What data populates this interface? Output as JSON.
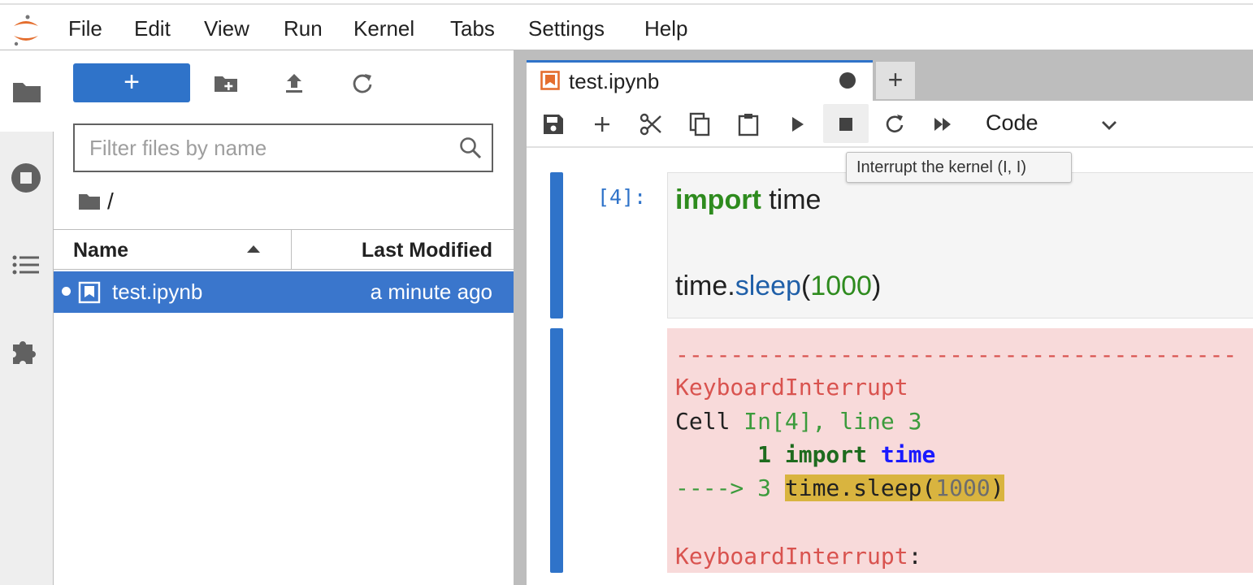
{
  "menu": {
    "items": [
      "File",
      "Edit",
      "View",
      "Run",
      "Kernel",
      "Tabs",
      "Settings",
      "Help"
    ]
  },
  "activity_bar": {
    "icons": [
      "folder-icon",
      "running-stop-icon",
      "toc-list-icon",
      "extension-puzzle-icon"
    ]
  },
  "file_browser": {
    "new_label": "+",
    "filter": {
      "placeholder": "Filter files by name",
      "value": ""
    },
    "breadcrumb": "/",
    "columns": {
      "name": "Name",
      "modified": "Last Modified"
    },
    "files": [
      {
        "name": "test.ipynb",
        "modified": "a minute ago",
        "selected": true,
        "running": true
      }
    ]
  },
  "notebook": {
    "tab_title": "test.ipynb",
    "add_tab_label": "+",
    "cell_type": "Code",
    "tooltip": "Interrupt the kernel (I, I)",
    "cell": {
      "prompt": "[4]:",
      "code": {
        "line1_kw": "import",
        "line1_rest": " time",
        "line3_obj": "time.",
        "line3_fn": "sleep",
        "line3_open": "(",
        "line3_num": "1000",
        "line3_close": ")"
      }
    },
    "output": {
      "dashes": "-----------------------------------------",
      "error_name": "KeyboardInterrupt",
      "cell_prefix": "Cell ",
      "cell_ref": "In[4], line 3",
      "ln1_num": "      1 ",
      "ln1_kw": "import",
      "ln1_sp": " ",
      "ln1_mod": "time",
      "ln3_arrow": "----> 3 ",
      "ln3_code": "time.sleep(",
      "ln3_num": "1000",
      "ln3_close": ")",
      "final_error": "KeyboardInterrupt",
      "final_colon": ":"
    }
  },
  "colors": {
    "accent": "#2f73c9",
    "error_bg": "#f8dada",
    "highlight": "#d9b43f"
  }
}
